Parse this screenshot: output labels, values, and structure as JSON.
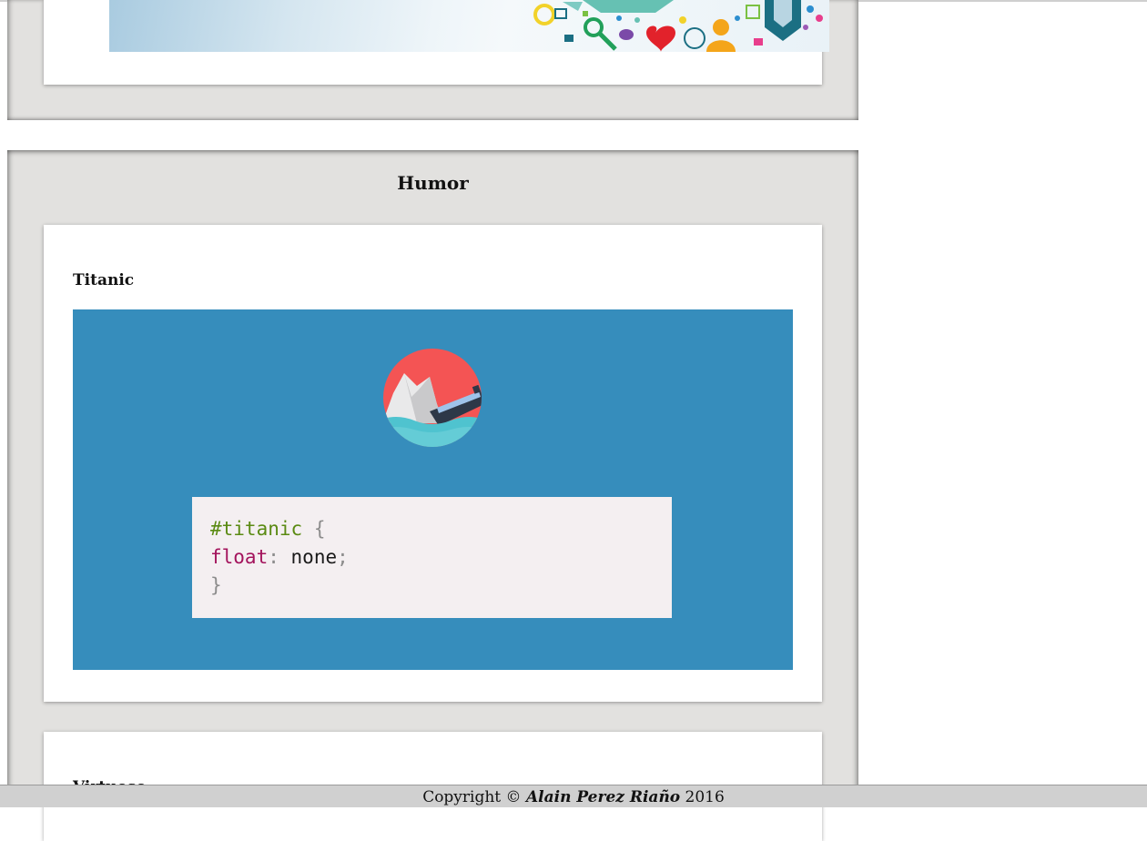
{
  "sections": [
    {
      "title": "",
      "cards": [
        {
          "image": "social-media-banner"
        }
      ]
    },
    {
      "title": "Humor",
      "cards": [
        {
          "title": "Titanic",
          "image": "titanic-css-joke",
          "code": {
            "selector": "#titanic",
            "open_brace": "{",
            "property": "float",
            "colon": ":",
            "value": "none",
            "semicolon": ";",
            "close_brace": "}"
          }
        },
        {
          "title": "Virtuoso"
        }
      ]
    }
  ],
  "footer": {
    "prefix": "Copyright ©",
    "author": "Alain Perez Riaño",
    "year": "2016"
  },
  "colors": {
    "section_bg": "#e2e1df",
    "titanic_bg": "#368dbc",
    "code_bg": "#f4eff1",
    "footer_bg": "#d0d0d0"
  }
}
